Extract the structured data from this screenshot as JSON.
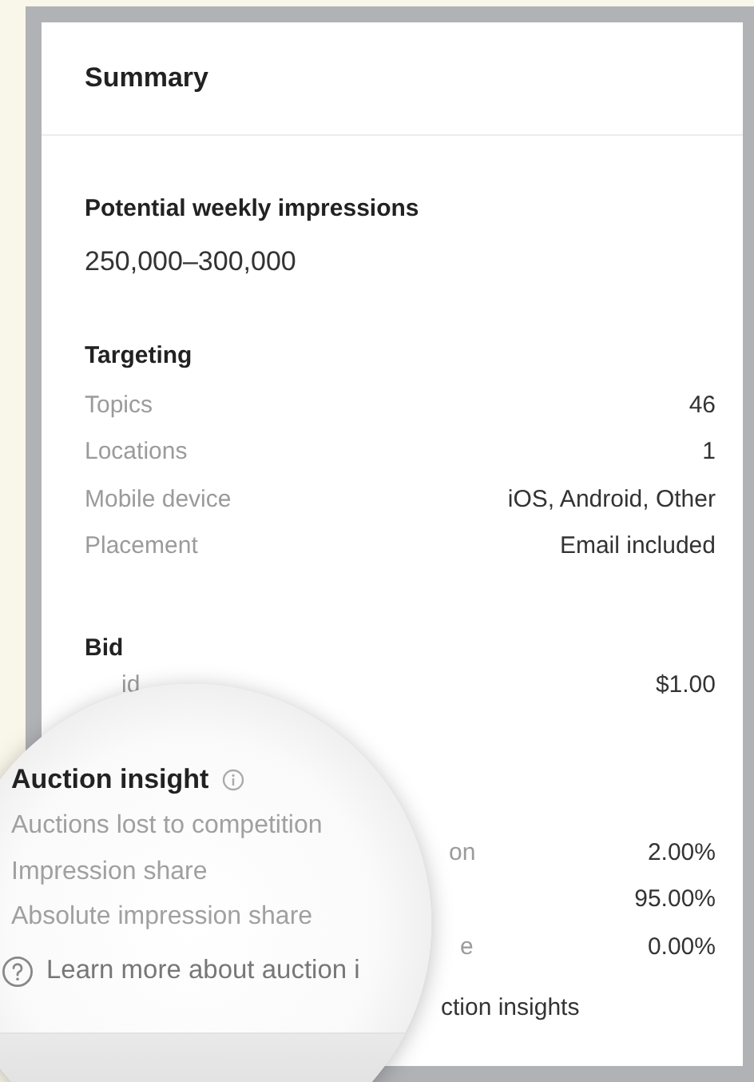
{
  "summary": {
    "title": "Summary"
  },
  "impressions": {
    "title": "Potential weekly impressions",
    "value": "250,000–300,000"
  },
  "targeting": {
    "title": "Targeting",
    "rows": [
      {
        "label": "Topics",
        "value": "46"
      },
      {
        "label": "Locations",
        "value": "1"
      },
      {
        "label": "Mobile device",
        "value": "iOS, Android, Other"
      },
      {
        "label": "Placement",
        "value": "Email included"
      }
    ]
  },
  "bid": {
    "title": "Bid",
    "rows": [
      {
        "label": "id",
        "value": "$1.00"
      }
    ]
  },
  "auction_insight": {
    "title": "Auction insight",
    "rows": [
      {
        "label": "Auctions lost to competition",
        "label_behind_lens": "on",
        "value": "2.00%"
      },
      {
        "label": "Impression share",
        "value": "95.00%"
      },
      {
        "label": "Absolute impression share",
        "label_behind_lens": "e",
        "value": "0.00%"
      }
    ],
    "link": "Learn more about auction i",
    "link_behind_lens": "ction insights"
  }
}
